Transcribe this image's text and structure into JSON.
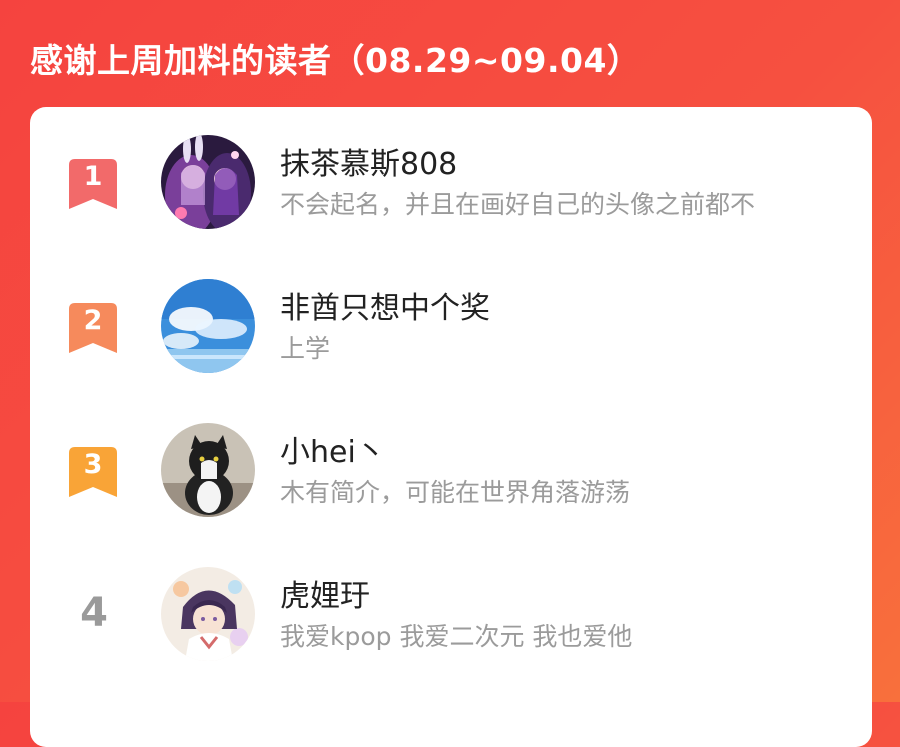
{
  "header": {
    "title": "感谢上周加料的读者（08.29~09.04）"
  },
  "colors": {
    "rank1": "#f26a6a",
    "rank2": "#f68a5c",
    "rank3": "#f9a437",
    "rank_other": "#9a9a9a"
  },
  "readers": [
    {
      "rank": "1",
      "name": "抹茶慕斯808",
      "bio": "不会起名，并且在画好自己的头像之前都不",
      "avatar": "anime-bunny-girls-avatar"
    },
    {
      "rank": "2",
      "name": "非酋只想中个奖",
      "bio": "上学",
      "avatar": "blue-sky-clouds-avatar"
    },
    {
      "rank": "3",
      "name": "小hei丶",
      "bio": "木有简介，可能在世界角落游荡",
      "avatar": "black-white-cat-avatar"
    },
    {
      "rank": "4",
      "name": "虎娌玗",
      "bio": "我爱kpop 我爱二次元 我也爱他",
      "avatar": "anime-character-avatar"
    }
  ]
}
